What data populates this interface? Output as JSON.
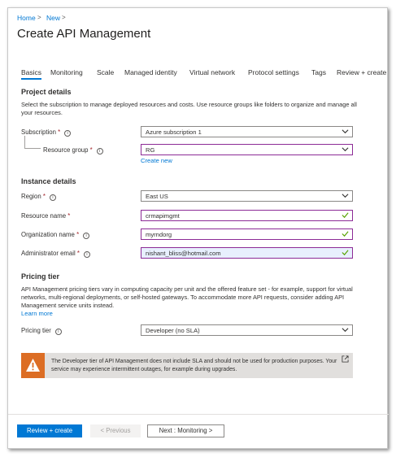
{
  "breadcrumb": [
    "Home",
    "New"
  ],
  "page_title": "Create API Management",
  "tabs": [
    {
      "label": "Basics",
      "active": true
    },
    {
      "label": "Monitoring"
    },
    {
      "label": "Scale"
    },
    {
      "label": "Managed identity"
    },
    {
      "label": "Virtual network"
    },
    {
      "label": "Protocol settings"
    },
    {
      "label": "Tags"
    },
    {
      "label": "Review + create"
    }
  ],
  "project_details": {
    "heading": "Project details",
    "description": "Select the subscription to manage deployed resources and costs. Use resource groups like folders to organize and manage all your resources.",
    "subscription": {
      "label": "Subscription",
      "value": "Azure subscription 1"
    },
    "resource_group": {
      "label": "Resource group",
      "value": "RG",
      "create_new": "Create new"
    }
  },
  "instance_details": {
    "heading": "Instance details",
    "region": {
      "label": "Region",
      "value": "East US"
    },
    "resource_name": {
      "label": "Resource name",
      "value": "crmapimgmt"
    },
    "organization_name": {
      "label": "Organization name",
      "value": "myrndorg"
    },
    "admin_email": {
      "label": "Administrator email",
      "value": "nishant_bliss@hotmail.com"
    }
  },
  "pricing": {
    "heading": "Pricing tier",
    "description": "API Management pricing tiers vary in computing capacity per unit and the offered feature set - for example, support for virtual networks, multi-regional deployments, or self-hosted gateways. To accommodate more API requests, consider adding API Management service units instead.",
    "learn_more": "Learn more",
    "tier": {
      "label": "Pricing tier",
      "value": "Developer (no SLA)"
    }
  },
  "warning": {
    "text": "The Developer tier of API Management does not include SLA and should not be used for production purposes. Your service may experience intermittent outages, for example during upgrades."
  },
  "footer": {
    "review_create": "Review + create",
    "previous": "< Previous",
    "next": "Next : Monitoring >"
  },
  "required_marker": "*",
  "info_glyph": "i",
  "colors": {
    "accent": "#0078d4",
    "warning": "#dc6d24",
    "required": "#a4262c",
    "valid": "#57a300"
  }
}
